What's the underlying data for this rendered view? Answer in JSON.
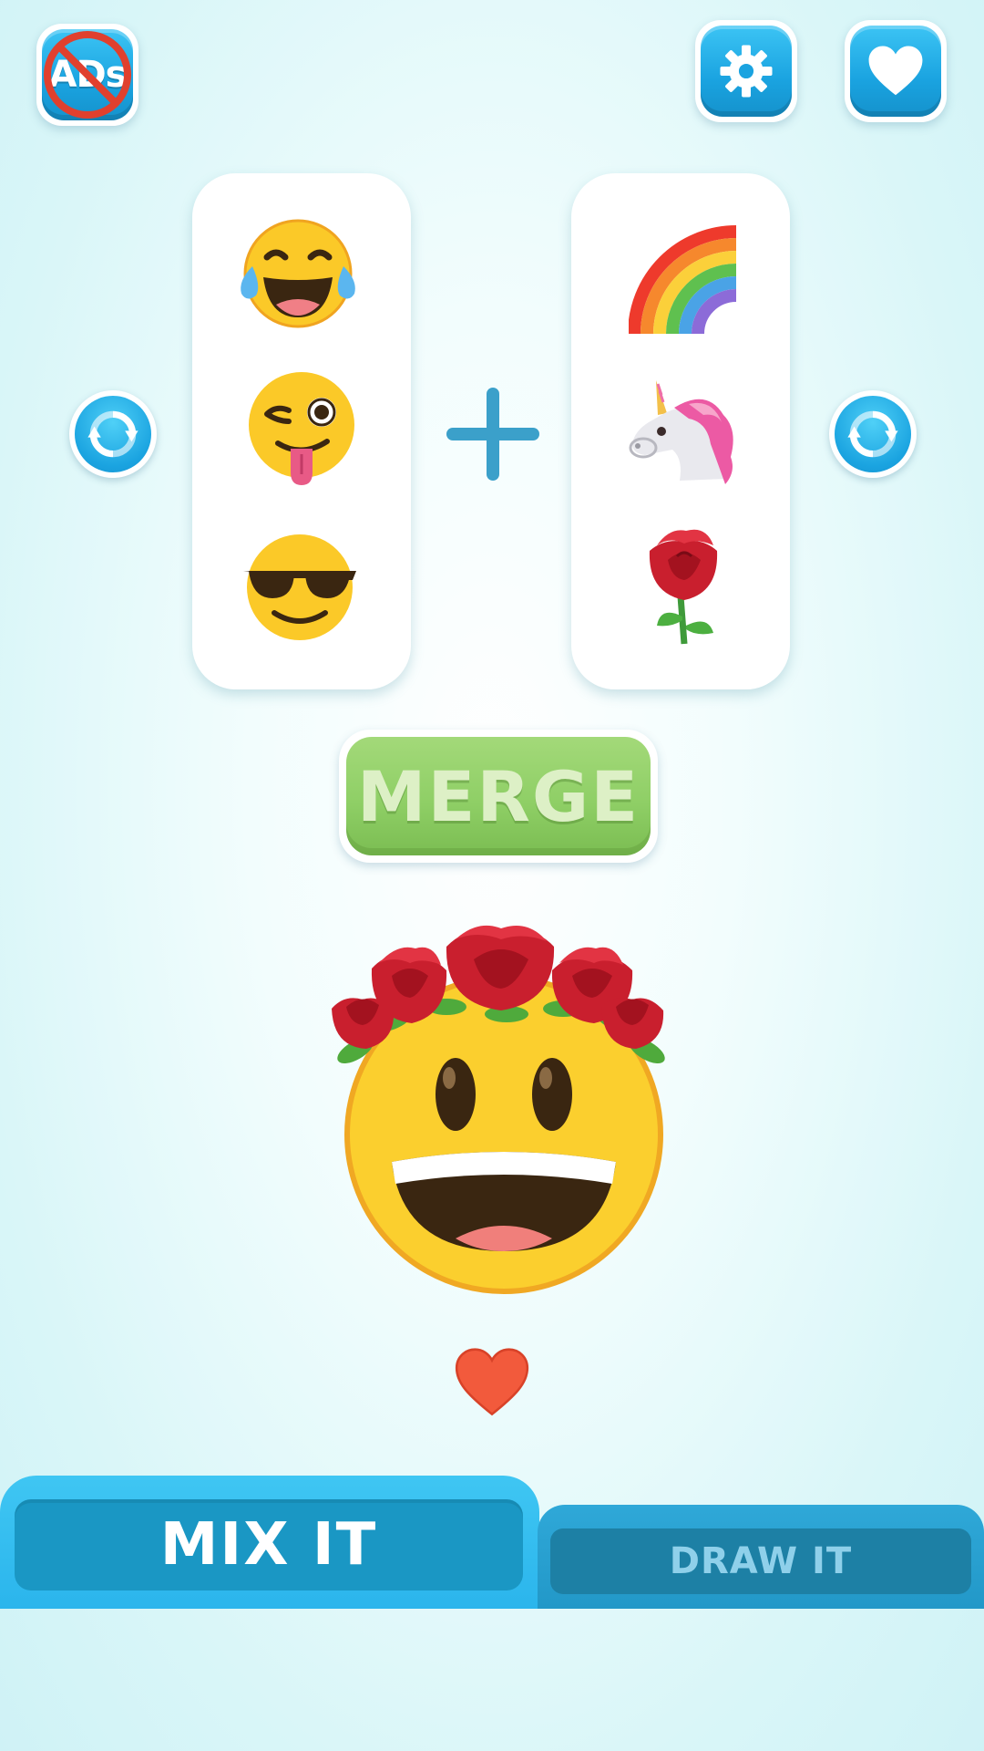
{
  "top_bar": {
    "remove_ads": {
      "label": "ADs",
      "icon": "no-ads-icon"
    },
    "settings": {
      "icon": "gear-icon"
    },
    "favorites": {
      "icon": "heart-icon"
    }
  },
  "left_column": {
    "emojis": [
      {
        "name": "face-with-tears-of-joy"
      },
      {
        "name": "winking-face-with-tongue"
      },
      {
        "name": "smiling-face-with-sunglasses"
      }
    ],
    "refresh_icon": "refresh-icon"
  },
  "right_column": {
    "emojis": [
      {
        "name": "rainbow"
      },
      {
        "name": "unicorn"
      },
      {
        "name": "rose"
      }
    ],
    "refresh_icon": "refresh-icon"
  },
  "plus_icon": "plus-icon",
  "merge_button": {
    "label": "MERGE"
  },
  "result": {
    "name": "grinning-face-with-rose-crown"
  },
  "like_icon": "heart-icon",
  "tabs": [
    {
      "label": "MIX IT",
      "active": true
    },
    {
      "label": "DRAW IT",
      "active": false
    }
  ],
  "colors": {
    "accent_blue": "#1aa3e0",
    "merge_green": "#8fcf66",
    "tab_active": "#1a97c4",
    "tab_inactive": "#1d80a5",
    "heart_red": "#f25a3c"
  }
}
